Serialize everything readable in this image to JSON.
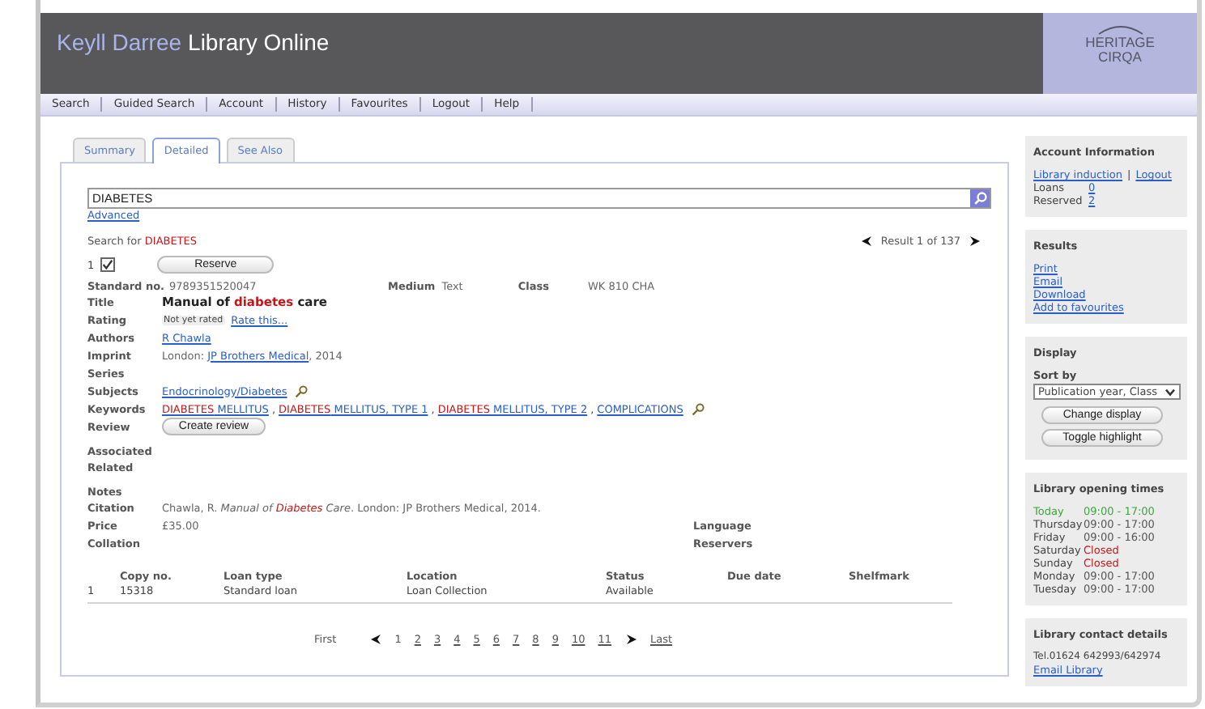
{
  "header": {
    "title_prefix": "Keyll Darree",
    "title_main": "Library Online",
    "logo_top": "HERITAGE",
    "logo_bottom": "CIRQA"
  },
  "nav": [
    "Search",
    "Guided Search",
    "Account",
    "History",
    "Favourites",
    "Logout",
    "Help"
  ],
  "tabs": [
    {
      "label": "Summary",
      "selected": false
    },
    {
      "label": "Detailed",
      "selected": true
    },
    {
      "label": "See Also",
      "selected": false
    }
  ],
  "search": {
    "value": "DIABETES",
    "advanced": "Advanced",
    "search_for": "Search for",
    "term": "DIABETES",
    "result": "Result 1 of 137"
  },
  "record": {
    "number": "1",
    "checked": true,
    "reserve": "Reserve",
    "standard_label": "Standard no.",
    "standard_value": "9789351520047",
    "medium_label": "Medium",
    "medium_value": "Text",
    "class_label": "Class",
    "class_value": "WK 810 CHA",
    "title_label": "Title",
    "title_parts": [
      {
        "text": "Manual of ",
        "highlight": false
      },
      {
        "text": "diabetes",
        "highlight": true
      },
      {
        "text": " care",
        "highlight": false
      }
    ],
    "rating_label": "Rating",
    "rating_badge": "Not yet rated",
    "rating_link": "Rate this...",
    "authors_label": "Authors",
    "authors_link": "R Chawla",
    "imprint_label": "Imprint",
    "imprint_prefix": "London: ",
    "imprint_link": "JP Brothers Medical",
    "imprint_suffix": ", 2014",
    "series_label": "Series",
    "subjects_label": "Subjects",
    "subjects_link": "Endocrinology/Diabetes",
    "keywords_label": "Keywords",
    "keyword_separator": ",",
    "keywords": [
      {
        "parts": [
          {
            "text": "DIABETES",
            "highlight": true
          },
          {
            "text": " MELLITUS",
            "highlight": false
          }
        ]
      },
      {
        "parts": [
          {
            "text": "DIABETES",
            "highlight": true
          },
          {
            "text": " MELLITUS, TYPE 1",
            "highlight": false
          }
        ]
      },
      {
        "parts": [
          {
            "text": "DIABETES",
            "highlight": true
          },
          {
            "text": " MELLITUS, TYPE 2",
            "highlight": false
          }
        ]
      },
      {
        "parts": [
          {
            "text": "COMPLICATIONS",
            "highlight": false
          }
        ]
      }
    ],
    "review_label": "Review",
    "review_button": "Create review",
    "associated_label": "Associated",
    "related_label": "Related",
    "notes_label": "Notes",
    "citation_label": "Citation",
    "citation_parts": [
      {
        "text": "Chawla, R. ",
        "italic": false,
        "highlight": false
      },
      {
        "text": "Manual of ",
        "italic": true,
        "highlight": false
      },
      {
        "text": "Diabetes",
        "italic": true,
        "highlight": true
      },
      {
        "text": " Care",
        "italic": true,
        "highlight": false
      },
      {
        "text": ". London: JP Brothers Medical, 2014.",
        "italic": false,
        "highlight": false
      }
    ],
    "price_label": "Price",
    "price_value": "£35.00",
    "language_label": "Language",
    "collation_label": "Collation",
    "reservers_label": "Reservers"
  },
  "copies": {
    "columns": [
      "Copy no.",
      "Loan type",
      "Location",
      "Status",
      "Due date",
      "Shelfmark"
    ],
    "rows": [
      {
        "number": "1",
        "cells": [
          "15318",
          "Standard loan",
          "Loan Collection",
          "Available"
        ]
      }
    ]
  },
  "pagination": {
    "first": "First",
    "pages": [
      {
        "label": "1",
        "selected": true
      },
      {
        "label": "2",
        "selected": false
      },
      {
        "label": "3",
        "selected": false
      },
      {
        "label": "4",
        "selected": false
      },
      {
        "label": "5",
        "selected": false
      },
      {
        "label": "6",
        "selected": false
      },
      {
        "label": "7",
        "selected": false
      },
      {
        "label": "8",
        "selected": false
      },
      {
        "label": "9",
        "selected": false
      },
      {
        "label": "10",
        "selected": false
      },
      {
        "label": "11",
        "selected": false
      }
    ],
    "last": "Last"
  },
  "sidebar": {
    "account": {
      "heading": "Account Information",
      "link_a": "Library induction",
      "separator": "|",
      "link_b": "Logout",
      "loans_label": "Loans",
      "loans_value": "0",
      "reserved_label": "Reserved",
      "reserved_value": "2"
    },
    "results": {
      "heading": "Results",
      "links": [
        "Print",
        "Email",
        "Download",
        "Add to favourites"
      ]
    },
    "display": {
      "heading": "Display",
      "sort_label": "Sort by",
      "sort_value": "Publication year, Class",
      "buttons": [
        "Change display",
        "Toggle highlight"
      ]
    },
    "hours": {
      "heading": "Library opening times",
      "rows": [
        {
          "day": "Today",
          "time": "09:00 - 17:00",
          "kind": "today"
        },
        {
          "day": "Thursday",
          "time": "09:00 - 17:00",
          "kind": "open"
        },
        {
          "day": "Friday",
          "time": "09:00 - 16:00",
          "kind": "open"
        },
        {
          "day": "Saturday",
          "time": "Closed",
          "kind": "closed"
        },
        {
          "day": "Sunday",
          "time": "Closed",
          "kind": "closed"
        },
        {
          "day": "Monday",
          "time": "09:00 - 17:00",
          "kind": "open"
        },
        {
          "day": "Tuesday",
          "time": "09:00 - 17:00",
          "kind": "open"
        }
      ]
    },
    "contact": {
      "heading": "Library contact details",
      "phone": "Tel.01624 642993/642974",
      "link": "Email Library"
    }
  }
}
